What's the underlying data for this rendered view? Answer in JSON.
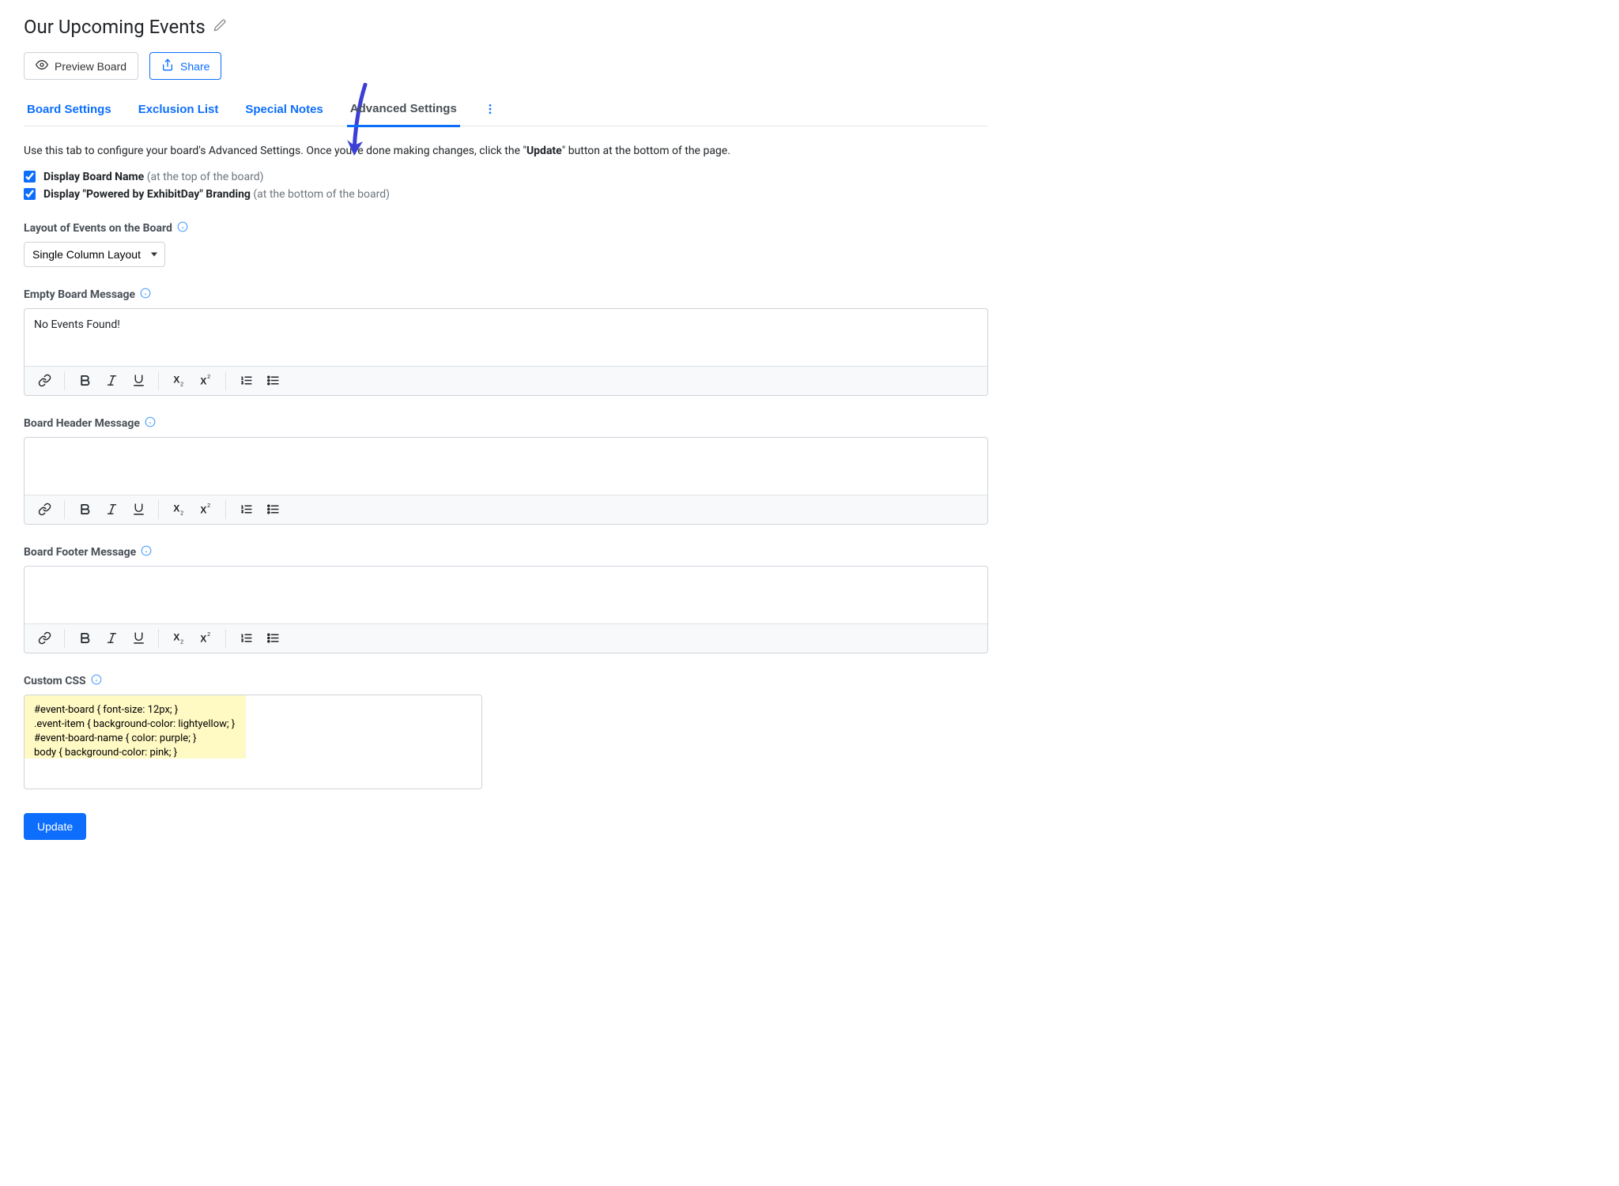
{
  "pageTitle": "Our Upcoming Events",
  "previewBoardLabel": "Preview Board",
  "shareLabel": "Share",
  "tabs": {
    "boardSettings": "Board Settings",
    "exclusionList": "Exclusion List",
    "specialNotes": "Special Notes",
    "advancedSettings": "Advanced Settings"
  },
  "introPrefix": "Use this tab to configure your board's Advanced Settings. Once you're done making changes, click the \"",
  "introBold": "Update",
  "introSuffix": "\" button at the bottom of the page.",
  "checkboxes": {
    "displayBoardName": {
      "bold": "Display Board Name",
      "hint": " (at the top of the board)",
      "checked": true
    },
    "displayBranding": {
      "bold": "Display \"Powered by ExhibitDay\" Branding",
      "hint": " (at the bottom of the board)",
      "checked": true
    }
  },
  "labels": {
    "layout": "Layout of Events on the Board",
    "emptyBoard": "Empty Board Message",
    "headerMsg": "Board Header Message",
    "footerMsg": "Board Footer Message",
    "customCss": "Custom CSS"
  },
  "layoutSelected": "Single Column Layout",
  "emptyBoardValue": "No Events Found!",
  "headerMsgValue": "",
  "footerMsgValue": "",
  "customCssValue": "#event-board { font-size: 12px; }\n.event-item { background-color: lightyellow; }\n#event-board-name { color: purple; }\nbody { background-color: pink; }",
  "updateLabel": "Update"
}
